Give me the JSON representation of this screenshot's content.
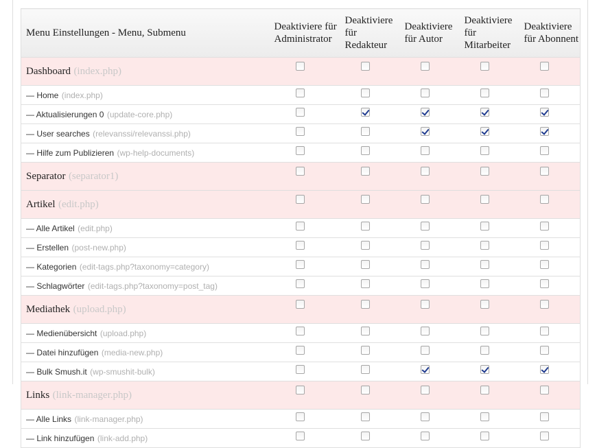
{
  "header": {
    "title": "Menu Einstellungen - Menu, Submenu",
    "roles": [
      "Deaktiviere für Administrator",
      "Deaktiviere für Redakteur",
      "Deaktiviere für Autor",
      "Deaktiviere für Mitarbeiter",
      "Deaktiviere für Abonnent"
    ]
  },
  "rows": [
    {
      "type": "menu",
      "label": "Dashboard",
      "file": "(index.php)",
      "checks": [
        false,
        false,
        false,
        false,
        false
      ]
    },
    {
      "type": "sub",
      "label": "— Home",
      "file": "(index.php)",
      "checks": [
        false,
        false,
        false,
        false,
        false
      ]
    },
    {
      "type": "sub",
      "label": "— Aktualisierungen 0",
      "file": "(update-core.php)",
      "checks": [
        false,
        true,
        true,
        true,
        true
      ]
    },
    {
      "type": "sub",
      "label": "— User searches",
      "file": "(relevanssi/relevanssi.php)",
      "checks": [
        false,
        false,
        true,
        true,
        true
      ]
    },
    {
      "type": "sub",
      "label": "— Hilfe zum Publizieren",
      "file": "(wp-help-documents)",
      "checks": [
        false,
        false,
        false,
        false,
        false
      ]
    },
    {
      "type": "menu",
      "label": "Separator",
      "file": "(separator1)",
      "checks": [
        false,
        false,
        false,
        false,
        false
      ]
    },
    {
      "type": "menu",
      "label": "Artikel",
      "file": "(edit.php)",
      "checks": [
        false,
        false,
        false,
        false,
        false
      ]
    },
    {
      "type": "sub",
      "label": "— Alle Artikel",
      "file": "(edit.php)",
      "checks": [
        false,
        false,
        false,
        false,
        false
      ]
    },
    {
      "type": "sub",
      "label": "— Erstellen",
      "file": "(post-new.php)",
      "checks": [
        false,
        false,
        false,
        false,
        false
      ]
    },
    {
      "type": "sub",
      "label": "— Kategorien",
      "file": "(edit-tags.php?taxonomy=category)",
      "checks": [
        false,
        false,
        false,
        false,
        false
      ]
    },
    {
      "type": "sub",
      "label": "— Schlagwörter",
      "file": "(edit-tags.php?taxonomy=post_tag)",
      "checks": [
        false,
        false,
        false,
        false,
        false
      ]
    },
    {
      "type": "menu",
      "label": "Mediathek",
      "file": "(upload.php)",
      "checks": [
        false,
        false,
        false,
        false,
        false
      ]
    },
    {
      "type": "sub",
      "label": "— Medienübersicht",
      "file": "(upload.php)",
      "checks": [
        false,
        false,
        false,
        false,
        false
      ]
    },
    {
      "type": "sub",
      "label": "— Datei hinzufügen",
      "file": "(media-new.php)",
      "checks": [
        false,
        false,
        false,
        false,
        false
      ]
    },
    {
      "type": "sub",
      "label": "— Bulk Smush.it",
      "file": "(wp-smushit-bulk)",
      "checks": [
        false,
        false,
        true,
        true,
        true
      ]
    },
    {
      "type": "menu",
      "label": "Links",
      "file": "(link-manager.php)",
      "checks": [
        false,
        false,
        false,
        false,
        false
      ]
    },
    {
      "type": "sub",
      "label": "— Alle Links",
      "file": "(link-manager.php)",
      "checks": [
        false,
        false,
        false,
        false,
        false
      ]
    },
    {
      "type": "sub",
      "label": "— Link hinzufügen",
      "file": "(link-add.php)",
      "checks": [
        false,
        false,
        false,
        false,
        false
      ]
    }
  ]
}
